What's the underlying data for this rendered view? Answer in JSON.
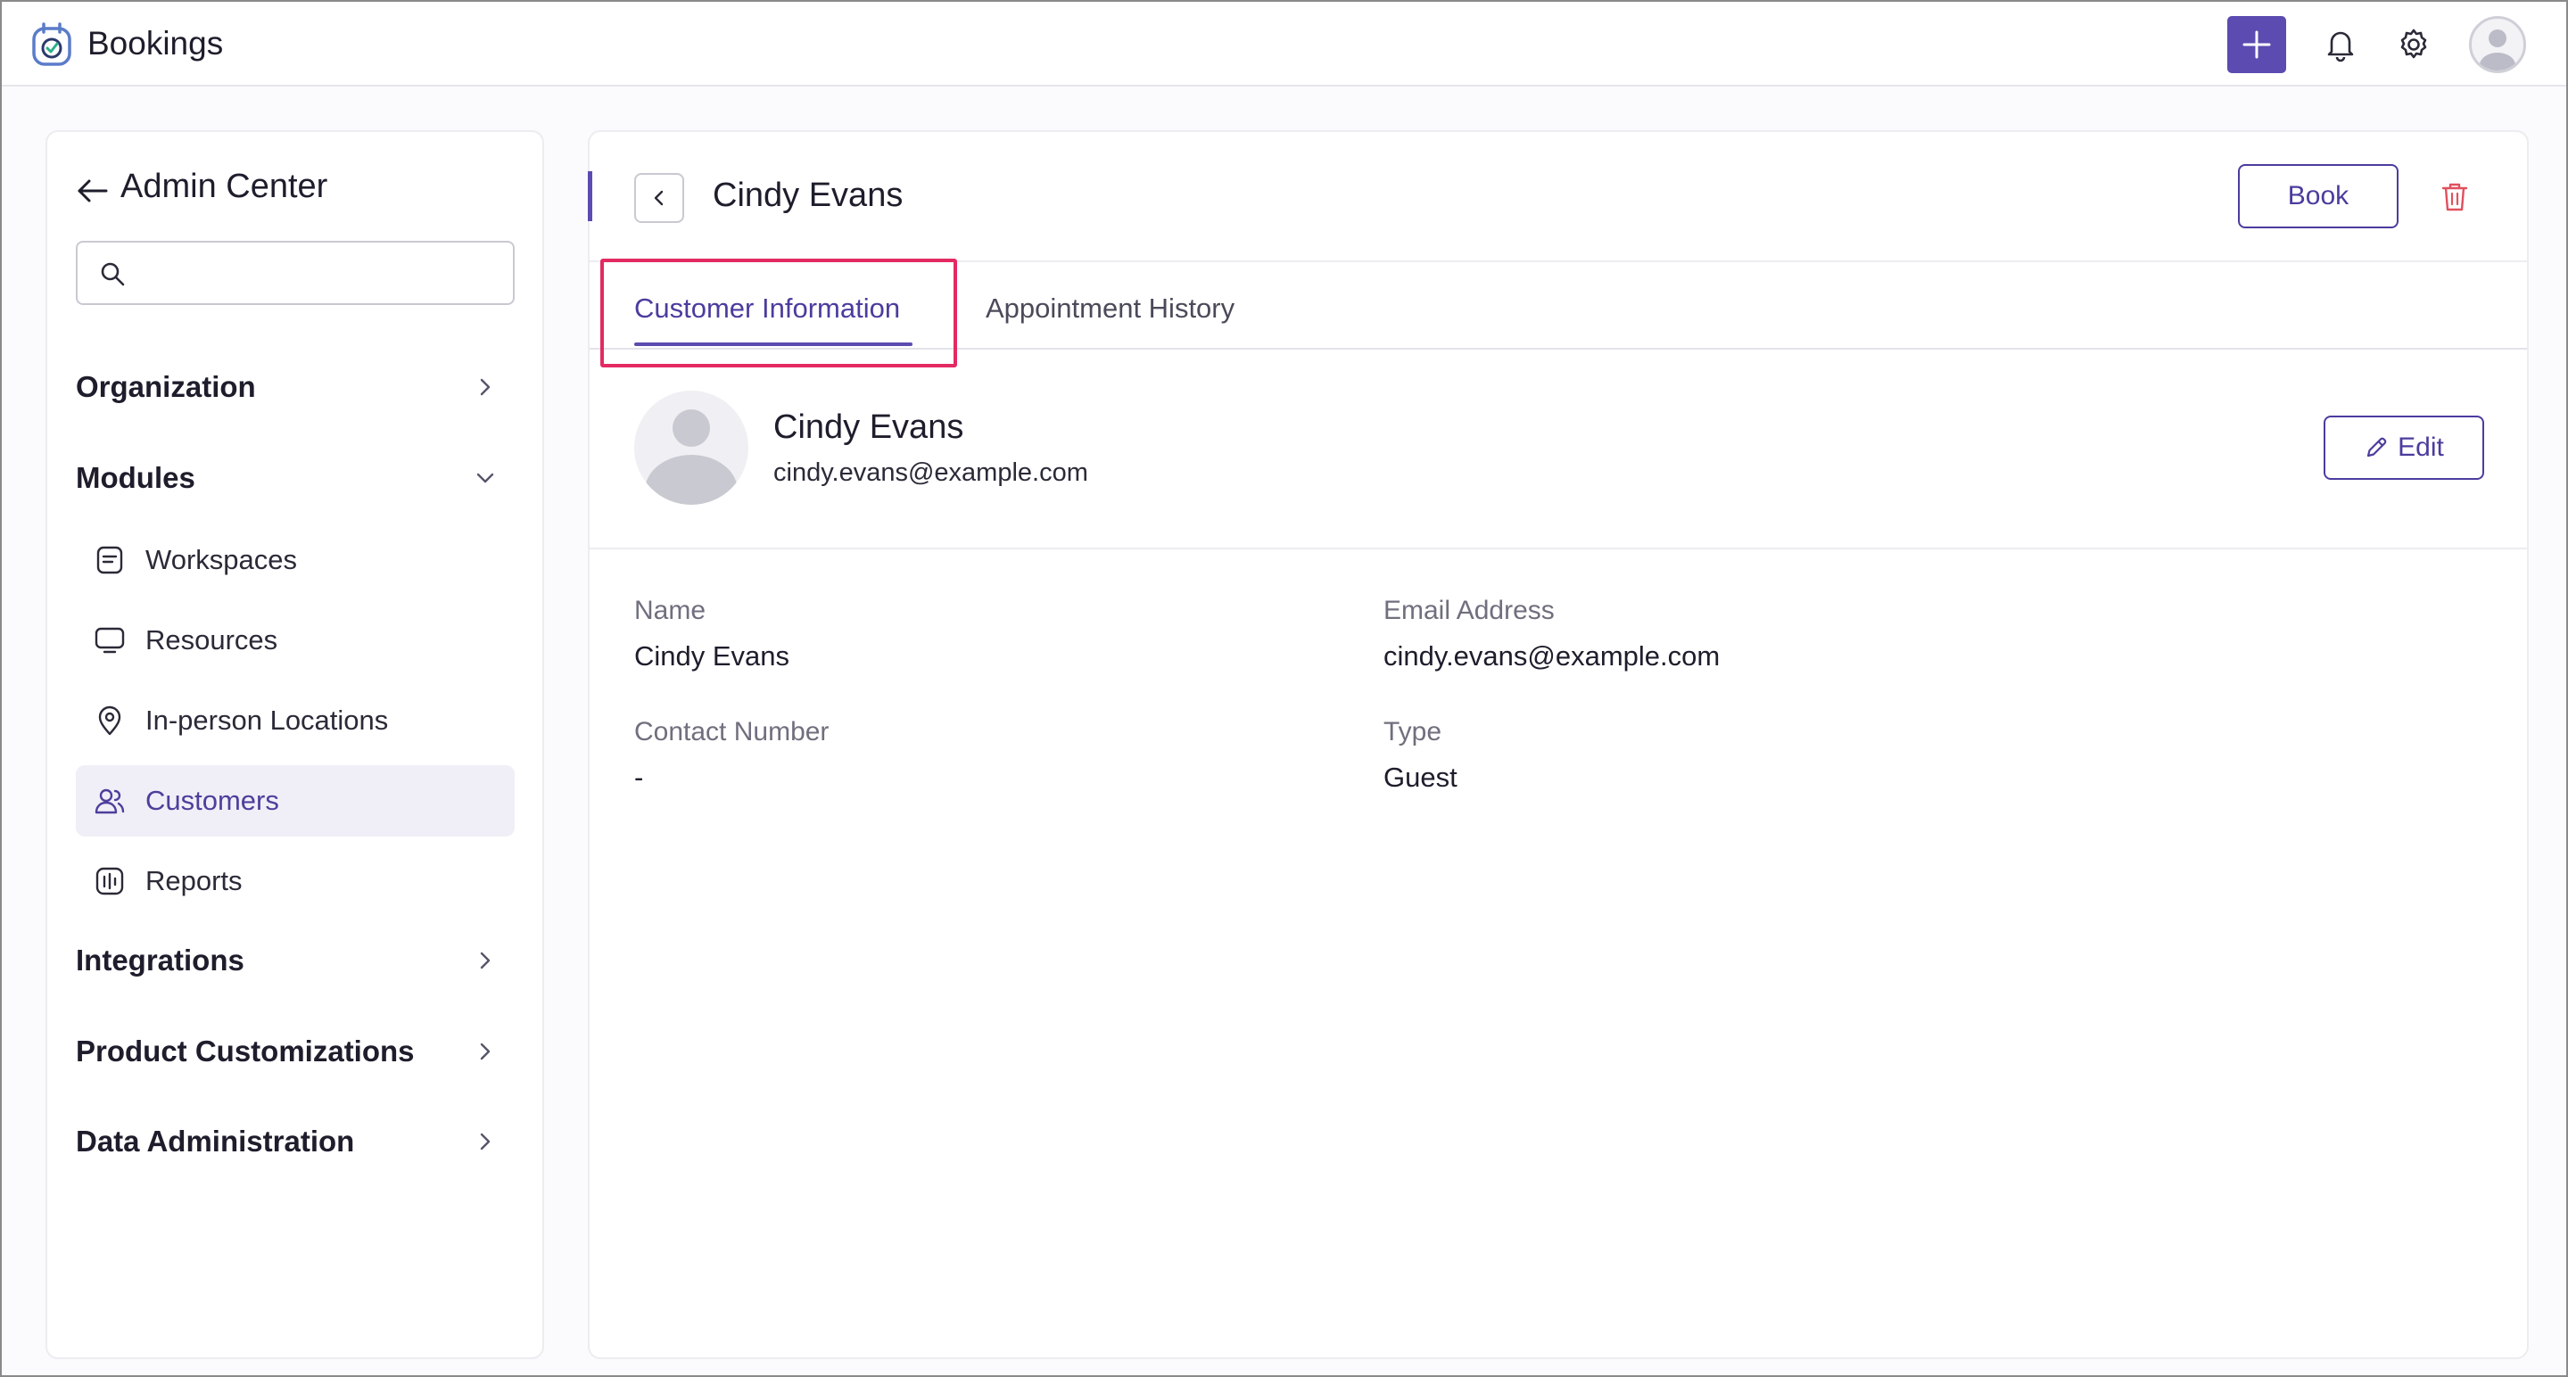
{
  "app": {
    "title": "Bookings"
  },
  "colors": {
    "accent": "#5c4bb0",
    "highlight": "#e32a62",
    "danger": "#e0505e"
  },
  "topbar": {
    "icons": [
      "add-icon",
      "bell-icon",
      "gear-icon",
      "avatar"
    ]
  },
  "sidebar": {
    "title": "Admin Center",
    "search": {
      "value": "",
      "placeholder": ""
    },
    "sections": [
      {
        "label": "Organization",
        "expanded": false
      },
      {
        "label": "Modules",
        "expanded": true
      },
      {
        "label": "Integrations",
        "expanded": false
      },
      {
        "label": "Product Customizations",
        "expanded": false
      },
      {
        "label": "Data Administration",
        "expanded": false
      }
    ],
    "module_items": [
      {
        "label": "Workspaces",
        "icon": "document-icon",
        "active": false
      },
      {
        "label": "Resources",
        "icon": "monitor-icon",
        "active": false
      },
      {
        "label": "In-person Locations",
        "icon": "location-pin-icon",
        "active": false
      },
      {
        "label": "Customers",
        "icon": "users-icon",
        "active": true
      },
      {
        "label": "Reports",
        "icon": "chart-icon",
        "active": false
      }
    ]
  },
  "main": {
    "title": "Cindy Evans",
    "book_label": "Book",
    "tabs": [
      {
        "label": "Customer Information",
        "active": true
      },
      {
        "label": "Appointment History",
        "active": false
      }
    ],
    "profile": {
      "name": "Cindy Evans",
      "email": "cindy.evans@example.com",
      "edit_label": "Edit"
    },
    "fields": {
      "name": {
        "label": "Name",
        "value": "Cindy Evans"
      },
      "email": {
        "label": "Email Address",
        "value": "cindy.evans@example.com"
      },
      "contact": {
        "label": "Contact Number",
        "value": "-"
      },
      "type": {
        "label": "Type",
        "value": "Guest"
      }
    }
  }
}
